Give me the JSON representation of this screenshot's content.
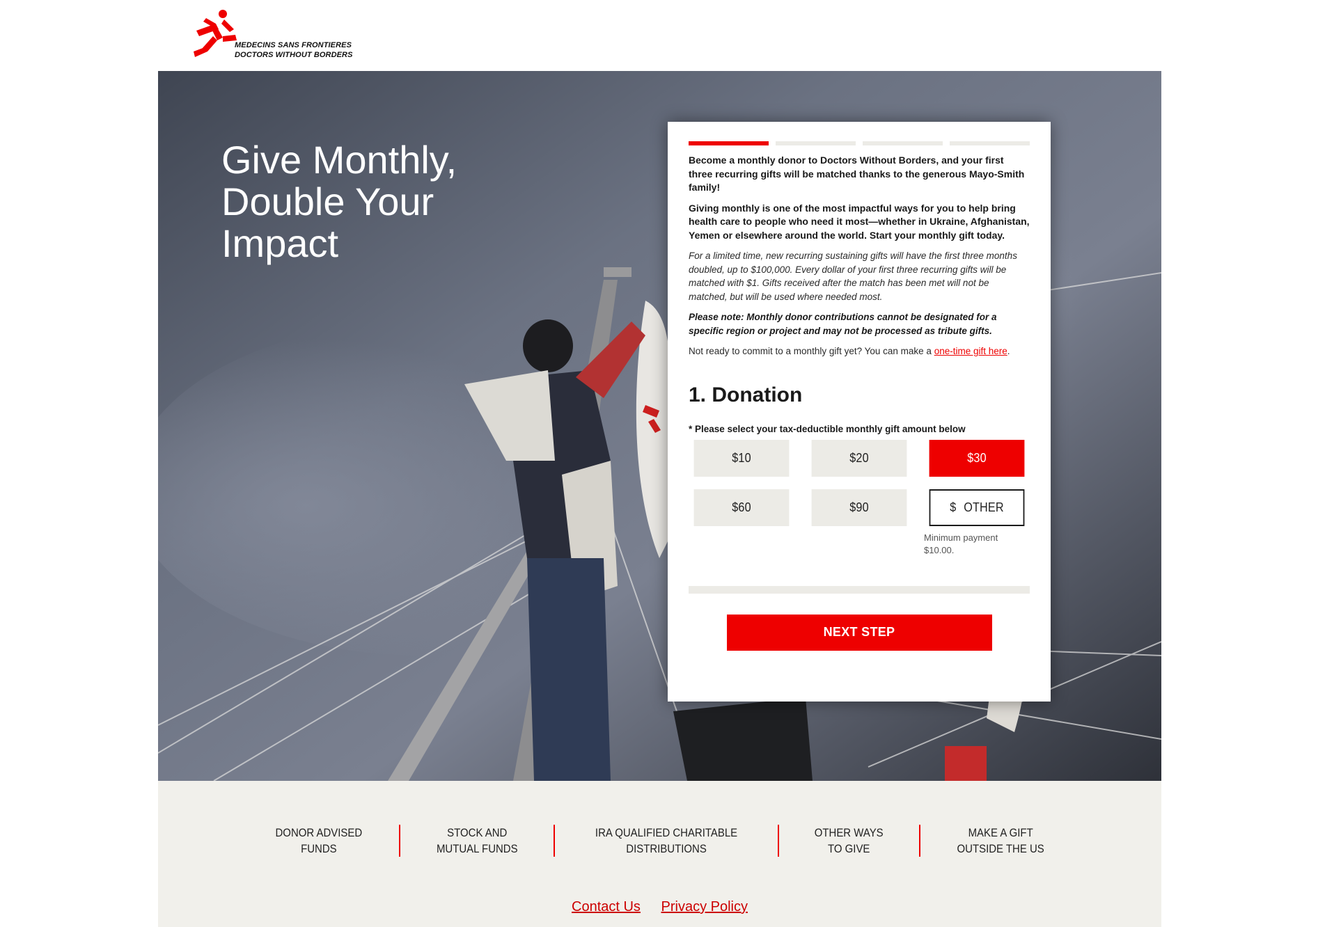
{
  "brand": {
    "line1": "MEDECINS SANS FRONTIERES",
    "line2": "DOCTORS WITHOUT BORDERS",
    "accent_color": "#ee0000"
  },
  "hero": {
    "title": "Give Monthly, Double Your Impact"
  },
  "form": {
    "steps_total": 4,
    "current_step": 1,
    "intro_bold_1": "Become a monthly donor to Doctors Without Borders, and your first three recurring gifts will be matched thanks to the generous Mayo-Smith family!",
    "intro_bold_2": "Giving monthly is one of the most impactful ways for you to help bring health care to people who need it most—whether in Ukraine, Afghanistan, Yemen or elsewhere around the world. Start your monthly gift today.",
    "intro_italic": "For a limited time, new recurring sustaining gifts will have the first three months doubled, up to $100,000. Every dollar of your first three recurring gifts will be matched with $1. Gifts received after the match has been met will not be matched, but will be used where needed most.",
    "note": "Please note: Monthly donor contributions cannot be designated for a specific region or project and may not be processed as tribute gifts.",
    "one_time_prefix": "Not ready to commit to a monthly gift yet? You can make a ",
    "one_time_link": "one-time gift here",
    "one_time_suffix": ".",
    "section_title": "1. Donation",
    "amount_label": "* Please select your tax-deductible monthly gift amount below",
    "amounts": [
      "$10",
      "$20",
      "$30",
      "$60",
      "$90"
    ],
    "selected_amount": "$30",
    "other_currency": "$",
    "other_placeholder": "OTHER",
    "min_payment": "Minimum payment $10.00.",
    "next_label": "NEXT STEP"
  },
  "footer": {
    "ways": [
      {
        "line1": "DONOR ADVISED",
        "line2": "FUNDS"
      },
      {
        "line1": "STOCK AND",
        "line2": "MUTUAL FUNDS"
      },
      {
        "line1": "IRA QUALIFIED CHARITABLE",
        "line2": "DISTRIBUTIONS"
      },
      {
        "line1": "OTHER WAYS",
        "line2": "TO GIVE"
      },
      {
        "line1": "MAKE A GIFT",
        "line2": "OUTSIDE THE US"
      }
    ],
    "contact_label": "Contact Us",
    "privacy_label": "Privacy Policy"
  }
}
